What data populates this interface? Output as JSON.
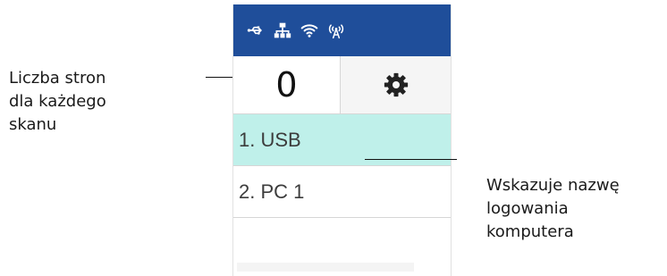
{
  "status_bar": {
    "icons": [
      "usb-icon",
      "network-icon",
      "wifi-icon",
      "wireless-direct-icon"
    ],
    "color": "#1f4e9a"
  },
  "top_row": {
    "page_count": "0",
    "settings_icon": "gear-icon"
  },
  "list": {
    "items": [
      {
        "label": "1. USB",
        "selected": true
      },
      {
        "label": "2. PC 1",
        "selected": false
      },
      {
        "label": "",
        "selected": false
      }
    ],
    "selected_color": "#bff0ea"
  },
  "annotations": {
    "left_lines": [
      "Liczba stron",
      "dla każdego",
      "skanu"
    ],
    "right_lines": [
      "Wskazuje nazwę",
      "logowania",
      "komputera"
    ]
  }
}
